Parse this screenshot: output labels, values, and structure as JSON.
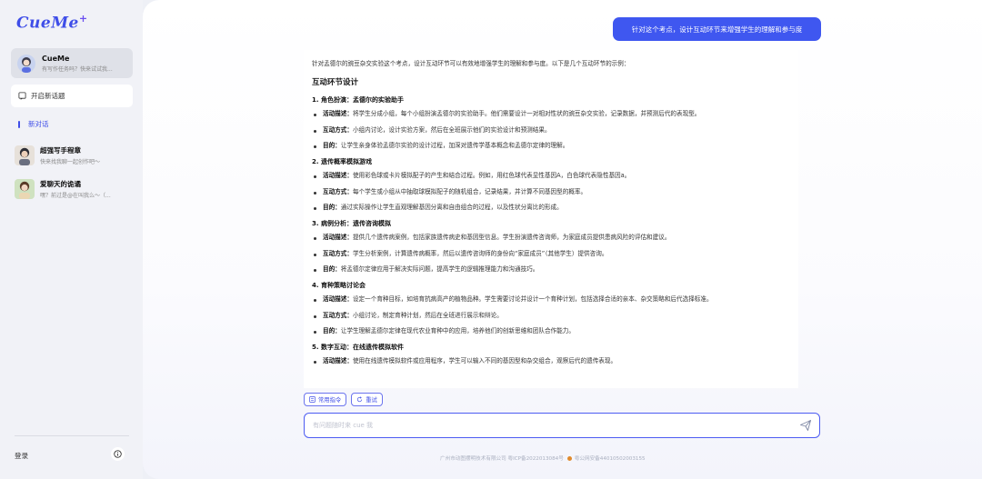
{
  "sidebar": {
    "logo": "CueMe",
    "logo_plus": "+",
    "assistant": {
      "name": "CueMe",
      "subtitle": "有写作任务吗？快来试试我..."
    },
    "new_topic_label": "开启新话题",
    "new_chat_label": "新对话",
    "history": [
      {
        "name": "超强写手程章",
        "subtitle": "快来找我聊一起创作吧～"
      },
      {
        "name": "爱聊天的诡谲",
        "subtitle": "嘿？前过是@在叫我么～（..."
      }
    ],
    "login_label": "登录"
  },
  "chat": {
    "user_message": "针对这个考点，设计互动环节来增强学生的理解和参与度",
    "answer": {
      "intro": "针对孟德尔的豌豆杂交实验这个考点，设计互动环节可以有效地增强学生的理解和参与度。以下是几个互动环节的示例：",
      "heading": "互动环节设计",
      "sections": [
        {
          "title": "1. 角色扮演：孟德尔的实验助手",
          "items": [
            {
              "label": "活动描述：",
              "text": "将学生分成小组，每个小组扮演孟德尔的实验助手。他们需要设计一对相对性状的豌豆杂交实验，记录数据，并预测后代的表现型。"
            },
            {
              "label": "互动方式：",
              "text": "小组内讨论，设计实验方案，然后在全班展示他们的实验设计和预测结果。"
            },
            {
              "label": "目的：",
              "text": "让学生亲身体验孟德尔实验的设计过程，加深对遗传学基本概念和孟德尔定律的理解。"
            }
          ]
        },
        {
          "title": "2. 遗传概率模拟游戏",
          "items": [
            {
              "label": "活动描述：",
              "text": "使用彩色球或卡片模拟配子的产生和结合过程。例如，用红色球代表显性基因A，白色球代表隐性基因a。"
            },
            {
              "label": "互动方式：",
              "text": "每个学生或小组从中抽取球模拟配子的随机组合，记录结果，并计算不同基因型的概率。"
            },
            {
              "label": "目的：",
              "text": "通过实际操作让学生直观理解基因分离和自由组合的过程，以及性状分离比的形成。"
            }
          ]
        },
        {
          "title": "3. 病例分析：遗传咨询模拟",
          "items": [
            {
              "label": "活动描述：",
              "text": "提供几个遗传病案例，包括家族遗传病史和基因型信息。学生扮演遗传咨询师，为家庭成员提供患病风险的评估和建议。"
            },
            {
              "label": "互动方式：",
              "text": "学生分析案例，计算遗传病概率，然后以遗传咨询师的身份向“家庭成员”（其他学生）提供咨询。"
            },
            {
              "label": "目的：",
              "text": "将孟德尔定律应用于解决实际问题，提高学生的逻辑推理能力和沟通技巧。"
            }
          ]
        },
        {
          "title": "4. 育种策略讨论会",
          "items": [
            {
              "label": "活动描述：",
              "text": "设定一个育种目标，如培育抗病高产的植物品种。学生需要讨论并设计一个育种计划，包括选择合适的亲本、杂交策略和后代选择标准。"
            },
            {
              "label": "互动方式：",
              "text": "小组讨论，制定育种计划，然后在全班进行展示和辩论。"
            },
            {
              "label": "目的：",
              "text": "让学生理解孟德尔定律在现代农业育种中的应用，培养他们的创新思维和团队合作能力。"
            }
          ]
        },
        {
          "title": "5. 数字互动：在线遗传模拟软件",
          "items": [
            {
              "label": "活动描述：",
              "text": "使用在线遗传模拟软件或应用程序，学生可以输入不同的基因型和杂交组合，观察后代的遗传表现。"
            }
          ]
        }
      ]
    },
    "actions": {
      "common_label": "常用指令",
      "retry_label": "重试"
    },
    "input_placeholder": "有问题随时来 cue 我",
    "footer_company": "广州市动图摆明技术有限公司 粤ICP备2022013084号",
    "footer_police": "粤公网安备44010502003155"
  },
  "colors": {
    "accent": "#3f57f0",
    "sidebar_bg": "#f1f2f7"
  }
}
